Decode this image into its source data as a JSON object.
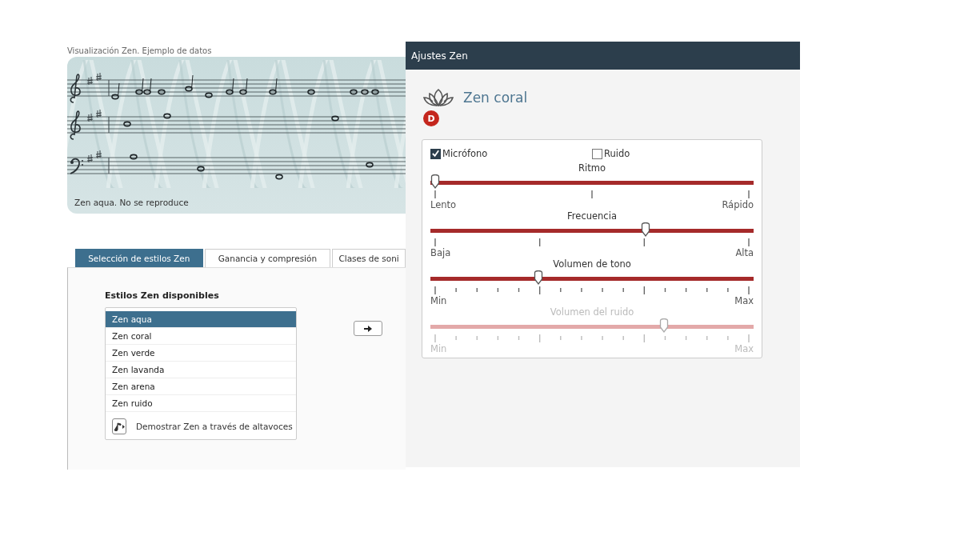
{
  "score": {
    "title": "Visualización Zen. Ejemplo de datos",
    "status": "Zen aqua. No se reproduce"
  },
  "tabs": [
    {
      "label": "Selección de estilos Zen",
      "selected": true
    },
    {
      "label": "Ganancia y compresión",
      "selected": false
    },
    {
      "label": "Clases de soni",
      "selected": false
    }
  ],
  "styles_panel": {
    "heading": "Estilos Zen disponibles",
    "items": [
      {
        "label": "Zen aqua",
        "selected": true
      },
      {
        "label": "Zen coral",
        "selected": false
      },
      {
        "label": "Zen verde",
        "selected": false
      },
      {
        "label": "Zen lavanda",
        "selected": false
      },
      {
        "label": "Zen arena",
        "selected": false
      },
      {
        "label": "Zen ruido",
        "selected": false
      }
    ],
    "demo_button": "Demostrar Zen a través de altavoces"
  },
  "settings": {
    "title": "Ajustes Zen",
    "style_name": "Zen coral",
    "badge": "D",
    "checkboxes": [
      {
        "label": "Micrófono",
        "checked": true
      },
      {
        "label": "Ruido",
        "checked": false
      }
    ],
    "sliders": [
      {
        "label": "Ritmo",
        "kind": "halves",
        "level": 0,
        "min_label": "Lento",
        "max_label": "Rápido",
        "disabled": false
      },
      {
        "label": "Frecuencia",
        "kind": "thirds",
        "level": 0.67,
        "min_label": "Baja",
        "max_label": "Alta",
        "disabled": false
      },
      {
        "label": "Volumen de tono",
        "kind": "fine",
        "level": 0.33,
        "min_label": "Min",
        "max_label": "Max",
        "disabled": false
      },
      {
        "label": "Volumen del ruido",
        "kind": "fine",
        "level": 0.73,
        "min_label": "Min",
        "max_label": "Max",
        "disabled": true
      }
    ]
  }
}
